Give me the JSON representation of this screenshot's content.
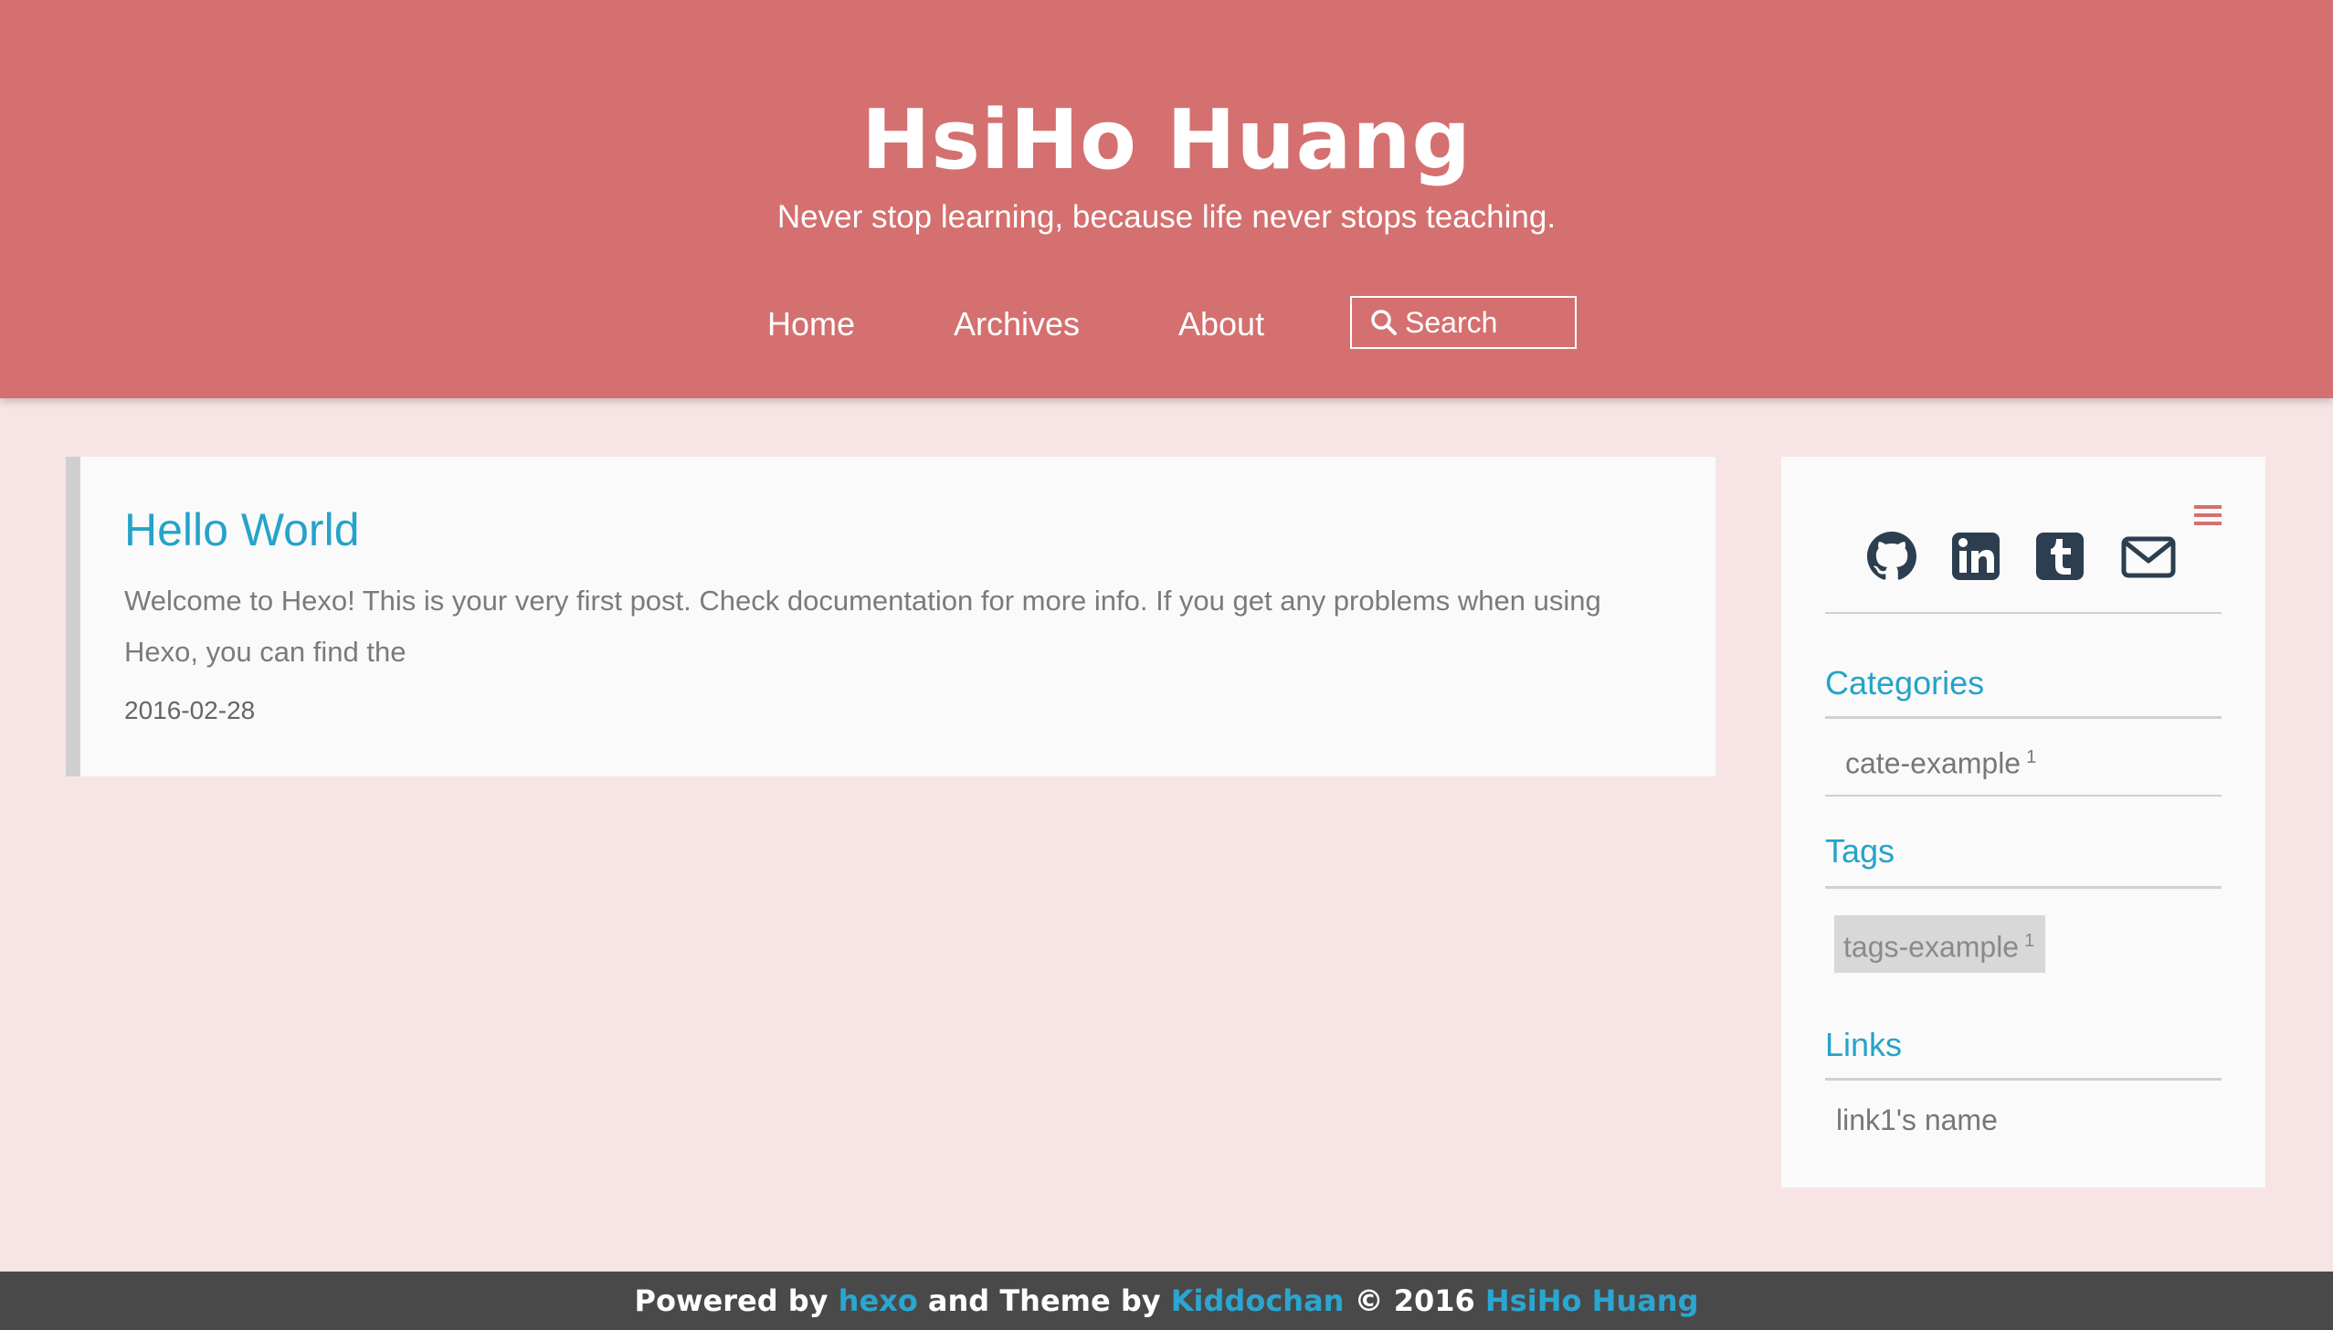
{
  "header": {
    "title": "HsiHo Huang",
    "subtitle": "Never stop learning, because life never stops teaching.",
    "nav": [
      "Home",
      "Archives",
      "About"
    ],
    "search_label": "Search"
  },
  "post": {
    "title": "Hello World",
    "excerpt": "Welcome to Hexo! This is your very first post. Check documentation for more info. If you get any problems when using Hexo, you can find the",
    "date": "2016-02-28"
  },
  "sidebar": {
    "social_icons": [
      "github-icon",
      "linkedin-icon",
      "tumblr-icon",
      "mail-icon"
    ],
    "categories_title": "Categories",
    "categories": [
      {
        "name": "cate-example",
        "count": "1"
      }
    ],
    "tags_title": "Tags",
    "tags": [
      {
        "name": "tags-example",
        "count": "1"
      }
    ],
    "links_title": "Links",
    "links": [
      {
        "name": "link1's name"
      }
    ]
  },
  "footer": {
    "powered_by": "Powered by",
    "hexo": "hexo",
    "theme_by": "and Theme by",
    "kiddochan": "Kiddochan",
    "copyright": "© 2016",
    "author": "HsiHo Huang"
  },
  "colors": {
    "header_bg": "#d4706f",
    "page_bg": "#f7e5e5",
    "accent": "#25a3c9",
    "footer_bg": "#4a4949",
    "icon": "#2c3e50"
  }
}
